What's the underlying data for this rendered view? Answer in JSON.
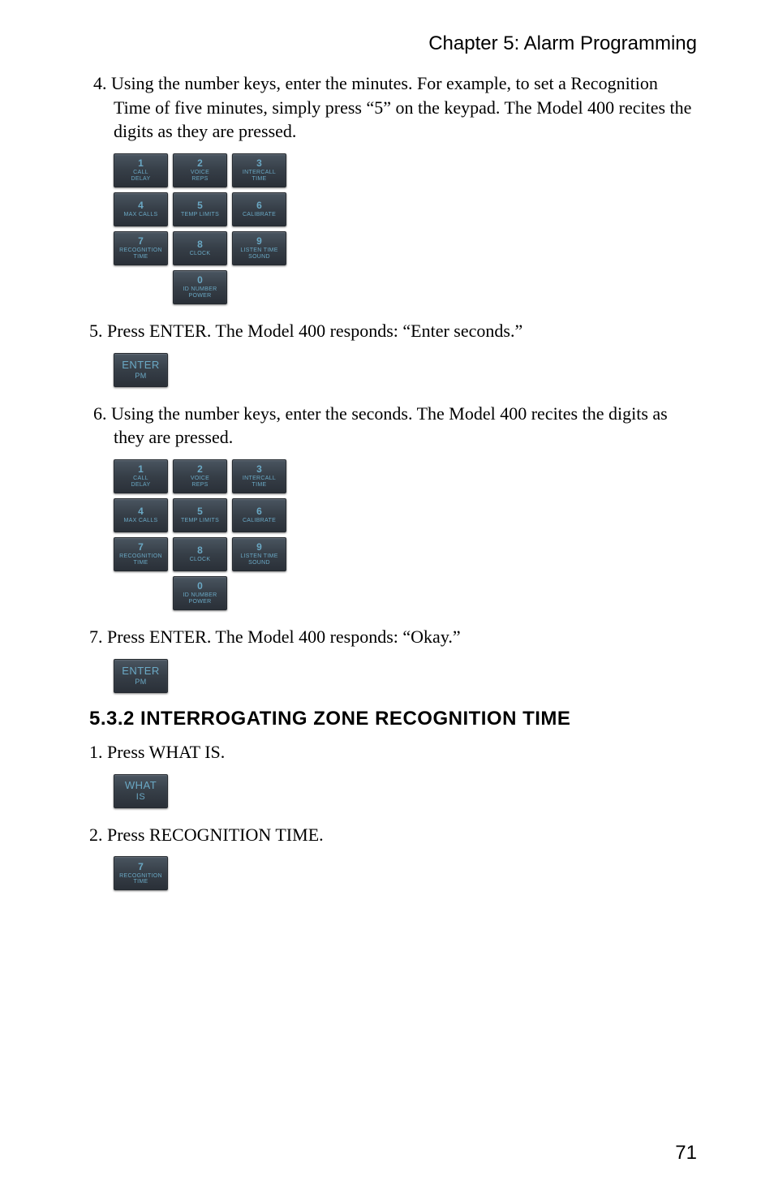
{
  "chapter": "Chapter 5: Alarm Programming",
  "step4": "4. Using the number keys, enter the minutes. For example, to set a Recognition Time of five minutes, simply press “5” on the keypad. The Model 400 recites the digits as they are pressed.",
  "step5": "5. Press ENTER. The Model 400 responds: “Enter seconds.”",
  "step6": "6. Using the number keys, enter the seconds. The Model 400 recites the digits as they are pressed.",
  "step7": "7. Press ENTER. The Model 400 responds: “Okay.”",
  "section_heading": "5.3.2 INTERROGATING ZONE RECOGNITION TIME",
  "sub_step1": "1. Press WHAT IS.",
  "sub_step2": "2. Press RECOGNITION TIME.",
  "keypad": {
    "keys": [
      {
        "num": "1",
        "label": "CALL\nDELAY"
      },
      {
        "num": "2",
        "label": "VOICE\nREPS"
      },
      {
        "num": "3",
        "label": "INTERCALL\nTIME"
      },
      {
        "num": "4",
        "label": "MAX CALLS"
      },
      {
        "num": "5",
        "label": "TEMP LIMITS"
      },
      {
        "num": "6",
        "label": "CALIBRATE"
      },
      {
        "num": "7",
        "label": "RECOGNITION\nTIME"
      },
      {
        "num": "8",
        "label": "CLOCK"
      },
      {
        "num": "9",
        "label": "LISTEN TIME\nSOUND"
      },
      {
        "num": "0",
        "label": "ID NUMBER\nPOWER"
      }
    ]
  },
  "enter_key": {
    "top": "ENTER",
    "bottom": "PM"
  },
  "whatis_key": {
    "top": "WHAT",
    "bottom": "IS"
  },
  "rec_key": {
    "num": "7",
    "label": "RECOGNITION\nTIME"
  },
  "page_num": "71"
}
